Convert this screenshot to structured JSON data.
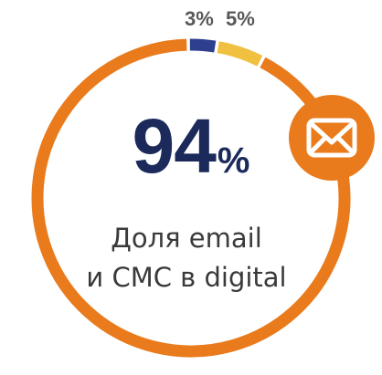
{
  "chart_data": {
    "type": "donut",
    "slices": [
      {
        "value": 94,
        "color": "#e97b1c"
      },
      {
        "label": "3%",
        "value": 3,
        "color": "#2e3f8f"
      },
      {
        "label": "5%",
        "value": 5,
        "color": "#f0c040"
      }
    ],
    "center": {
      "value": "94",
      "unit": "%",
      "caption_line1": "Доля email",
      "caption_line2": "и СМС в digital"
    }
  },
  "icons": {
    "badge": "envelope-icon"
  },
  "colors": {
    "accent": "#e97b1c",
    "value_text": "#1b2a5a",
    "caption_text": "#3a3a3a"
  }
}
